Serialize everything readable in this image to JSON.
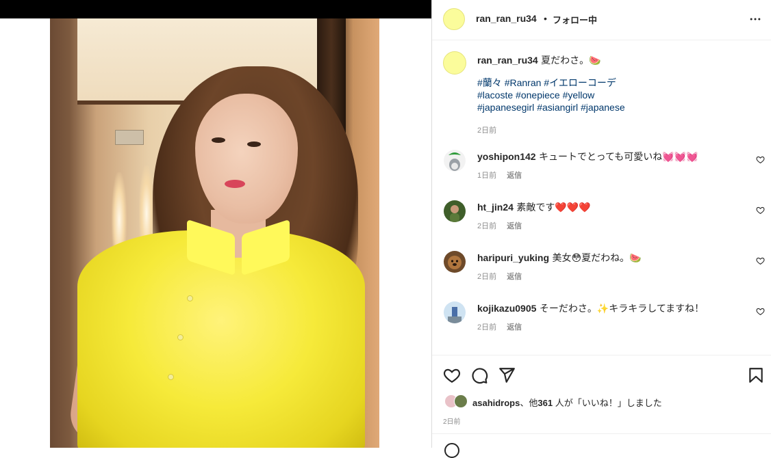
{
  "post": {
    "username": "ran_ran_ru34",
    "separator": "•",
    "follow_status": "フォロー中",
    "more_icon": "more-horizontal-icon"
  },
  "caption": {
    "username": "ran_ran_ru34",
    "text": "夏だわさ。🍉",
    "hashtag_lines": [
      [
        "#蘭々",
        "#Ranran",
        "#イエローコーデ"
      ],
      [
        "#lacoste",
        "#onepiece",
        "#yellow"
      ],
      [
        "#japanesegirl",
        "#asiangirl",
        "#japanese"
      ]
    ],
    "time": "2日前"
  },
  "comments": [
    {
      "username": "yoshipon142",
      "text": "キュートでとっても可愛いね💓💓💓",
      "time": "1日前",
      "reply": "返信"
    },
    {
      "username": "ht_jin24",
      "text": "素敵です❤️❤️❤️",
      "time": "2日前",
      "reply": "返信"
    },
    {
      "username": "haripuri_yuking",
      "text": "美女😳夏だわね。🍉",
      "time": "2日前",
      "reply": "返信"
    },
    {
      "username": "kojikazu0905",
      "text": "そーだわさ。✨キラキラしてますね！",
      "time": "2日前",
      "reply": "返信"
    }
  ],
  "likes": {
    "liker": "asahidrops",
    "mid": "、他",
    "count": "361",
    "suffix": " 人が「いいね！」しました"
  },
  "post_time": "2日前",
  "colors": {
    "hashtag": "#00376b",
    "avatar_yellow": "#fbfc9b",
    "muted": "#8e8e8e"
  }
}
